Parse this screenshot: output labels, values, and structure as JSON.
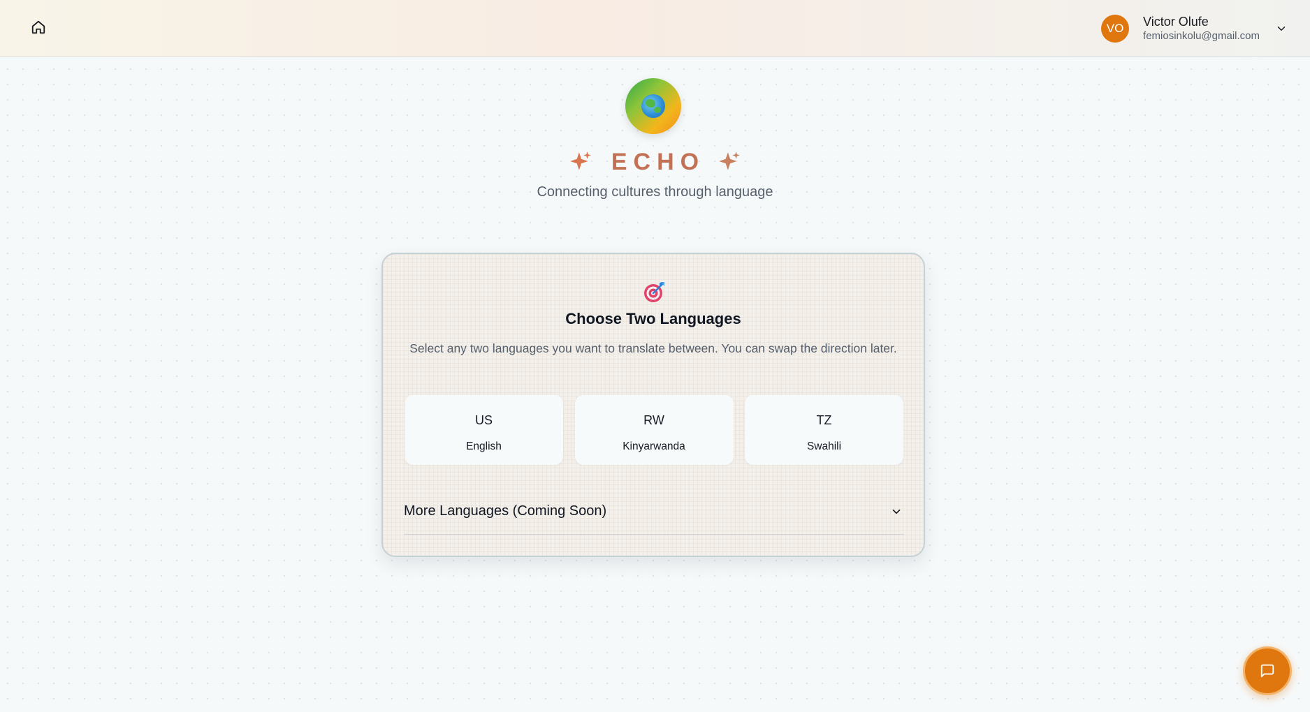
{
  "header": {
    "user": {
      "initials": "VO",
      "name": "Victor Olufe",
      "email": "femiosinkolu@gmail.com"
    }
  },
  "hero": {
    "brand": "ECHO",
    "tagline": "Connecting cultures through language"
  },
  "card": {
    "title": "Choose Two Languages",
    "description": "Select any two languages you want to translate between. You can swap the direction later.",
    "languages": [
      {
        "code": "US",
        "name": "English"
      },
      {
        "code": "RW",
        "name": "Kinyarwanda"
      },
      {
        "code": "TZ",
        "name": "Swahili"
      }
    ],
    "more_label": "More Languages (Coming Soon)"
  },
  "icons": {
    "home": "home-icon",
    "dropdown": "chevron-down-icon",
    "logo": "globe-icon",
    "sparkle": "sparkle-icon",
    "target": "target-icon",
    "chat": "chat-icon"
  },
  "colors": {
    "accent": "#e0770e",
    "brand_text": "#c27155",
    "sparkle": "#d8764f"
  }
}
